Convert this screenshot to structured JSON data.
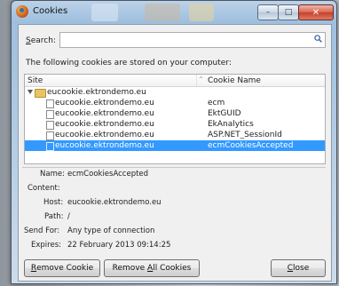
{
  "window": {
    "title": "Cookies",
    "close_glyph": "✕",
    "min_glyph": "–",
    "max_glyph": "□"
  },
  "search": {
    "label_underline": "S",
    "label_rest": "earch:",
    "value": ""
  },
  "info_text": "The following cookies are stored on your computer:",
  "table": {
    "col_site": "Site",
    "col_sort": "^",
    "col_name": "Cookie Name",
    "group": "eucookie.ektrondemo.eu",
    "rows": [
      {
        "site": "eucookie.ektrondemo.eu",
        "name": "ecm"
      },
      {
        "site": "eucookie.ektrondemo.eu",
        "name": "EktGUID"
      },
      {
        "site": "eucookie.ektrondemo.eu",
        "name": "EkAnalytics"
      },
      {
        "site": "eucookie.ektrondemo.eu",
        "name": "ASP.NET_SessionId"
      },
      {
        "site": "eucookie.ektrondemo.eu",
        "name": "ecmCookiesAccepted"
      }
    ],
    "selected_index": 4
  },
  "details": {
    "name_label": "Name:",
    "name_value": "ecmCookiesAccepted",
    "content_label": "Content:",
    "content_value": "",
    "host_label": "Host:",
    "host_value": "eucookie.ektrondemo.eu",
    "path_label": "Path:",
    "path_value": "/",
    "send_label": "Send For:",
    "send_value": "Any type of connection",
    "expires_label": "Expires:",
    "expires_value": "22 February 2013 09:14:25"
  },
  "buttons": {
    "remove_cookie_u": "R",
    "remove_cookie_rest": "emove Cookie",
    "remove_all_pre": "Remove ",
    "remove_all_u": "A",
    "remove_all_rest": "ll Cookies",
    "close_u": "C",
    "close_rest": "lose"
  },
  "icons": {
    "app": "firefox-icon",
    "search": "magnifier-icon",
    "folder": "folder-icon",
    "cookie": "document-icon"
  }
}
